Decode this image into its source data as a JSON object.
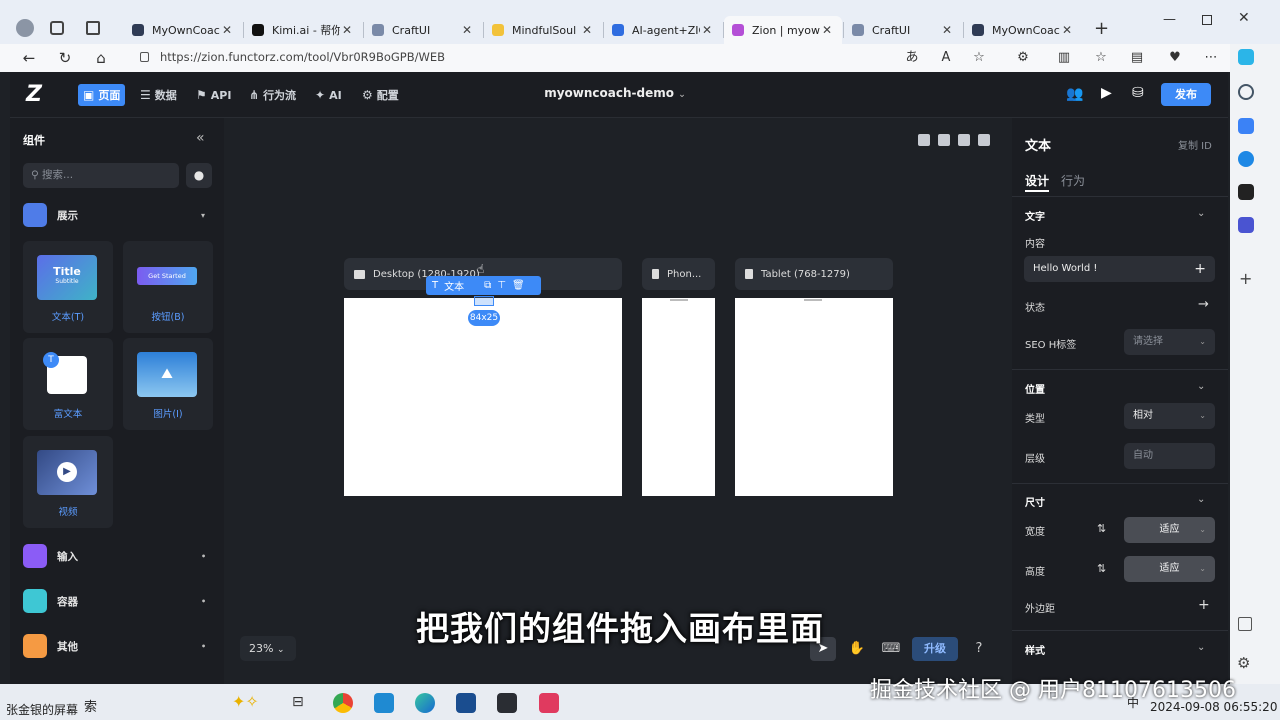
{
  "browser": {
    "tabs": [
      {
        "label": "MyOwnCoach ·",
        "color": "#2f3b55"
      },
      {
        "label": "Kimi.ai - 帮你看",
        "color": "#111111"
      },
      {
        "label": "CraftUI",
        "color": "#7a8aa8"
      },
      {
        "label": "MindfulSoul – ",
        "color": "#f2c23a"
      },
      {
        "label": "AI-agent+ZION",
        "color": "#2f6de0"
      },
      {
        "label": "Zion | myowno",
        "color": "#b44fd6"
      },
      {
        "label": "CraftUI",
        "color": "#7a8aa8"
      },
      {
        "label": "MyOwnCoach ·",
        "color": "#2f3b55"
      }
    ],
    "url": "https://zion.functorz.com/tool/Vbr0R9BoGPB/WEB"
  },
  "app": {
    "nav": {
      "page": "页面",
      "data": "数据",
      "api": "API",
      "flow": "行为流",
      "ai": "AI",
      "config": "配置"
    },
    "project": "myowncoach-demo",
    "publish": "发布"
  },
  "left": {
    "title": "组件",
    "search_placeholder": "搜索...",
    "sections": {
      "display": "展示",
      "input": "输入",
      "container": "容器",
      "other": "其他"
    },
    "cards": {
      "title": {
        "label": "文本(T)",
        "thumb_title": "Title",
        "thumb_sub": "Subtitle"
      },
      "button": {
        "label": "按钮(B)",
        "thumb_text": "Get Started"
      },
      "richtext": {
        "label": "富文本"
      },
      "image": {
        "label": "图片(I)"
      },
      "video": {
        "label": "视频"
      }
    }
  },
  "canvas": {
    "frames": {
      "desktop": "Desktop (1280-1920)",
      "phone": "Phon...",
      "tablet": "Tablet (768-1279)"
    },
    "selection_label": "文本",
    "size_badge": "84x25",
    "zoom": "23%",
    "upgrade": "升级",
    "help": "?"
  },
  "caption": "把我们的组件拖入画布里面",
  "right": {
    "title": "文本",
    "copy_id": "复制 ID",
    "tabs": {
      "design": "设计",
      "behavior": "行为"
    },
    "text_section": "文字",
    "content_label": "内容",
    "content_value": "Hello World !",
    "state_label": "状态",
    "seo_label": "SEO H标签",
    "seo_placeholder": "请选择",
    "position_section": "位置",
    "type_label": "类型",
    "type_value": "相对",
    "layer_label": "层级",
    "layer_value": "自动",
    "size_section": "尺寸",
    "width_label": "宽度",
    "width_value": "适应",
    "height_label": "高度",
    "height_value": "适应",
    "margin_label": "外边距",
    "style_section": "样式"
  },
  "taskbar": {
    "user": "张金银的屏幕",
    "search": "索",
    "ime": "中",
    "datetime": "2024-09-08 06:55:20",
    "watermark": "掘金技术社区 @ 用户81107613506"
  }
}
